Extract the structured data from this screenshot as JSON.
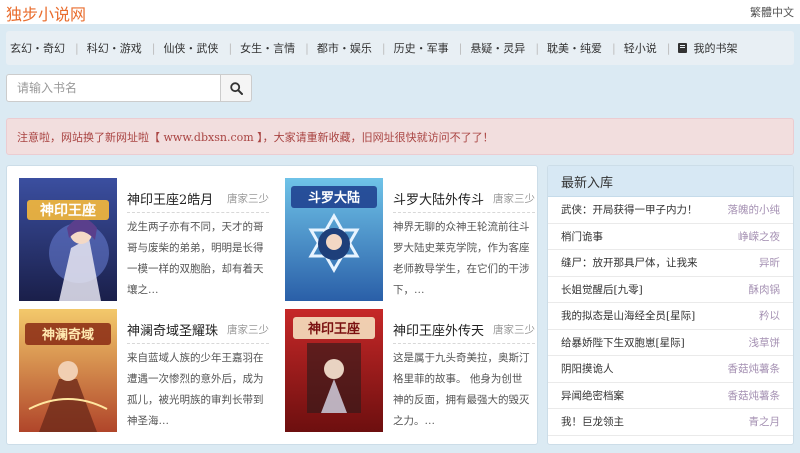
{
  "header": {
    "site_title": "独步小说网",
    "lang_toggle": "繁體中文"
  },
  "nav": {
    "items": [
      "玄幻・奇幻",
      "科幻・游戏",
      "仙侠・武侠",
      "女生・言情",
      "都市・娱乐",
      "历史・军事",
      "悬疑・灵异",
      "耽美・纯爱",
      "轻小说"
    ],
    "bookshelf": "我的书架",
    "separator": "|"
  },
  "search": {
    "placeholder": "请输入书名",
    "icon": "search-icon"
  },
  "notice": {
    "text": "注意啦，网站换了新网址啦【 www.dbxsn.com 】，大家请重新收藏，旧网址很快就访问不了了！"
  },
  "featured": [
    {
      "title": "神印王座2皓月",
      "author": "唐家三少",
      "desc": "龙生两子亦有不同，天才的哥哥与废柴的弟弟，明明是长得一模一样的双胞胎，却有着天壤之…",
      "cover_text": "神印王座"
    },
    {
      "title": "斗罗大陆外传斗",
      "author": "唐家三少",
      "desc": "神界无聊的众神王轮流前往斗罗大陆史莱克学院，作为客座老师教导学生，在它们的干涉下，…",
      "cover_text": "斗罗大陆"
    },
    {
      "title": "神澜奇域圣耀珠",
      "author": "唐家三少",
      "desc": "来自蓝域人族的少年王嘉羽在遭遇一次惨烈的意外后，成为孤儿，被光明族的审判长带到神圣海…",
      "cover_text": "神澜奇域"
    },
    {
      "title": "神印王座外传天",
      "author": "唐家三少",
      "desc": "这是属于九头奇美拉，奥斯汀格里菲的故事。 他身为创世神的反面，拥有最强大的毁灭之力。…",
      "cover_text": "神印王座"
    }
  ],
  "sidebar": {
    "heading": "最新入库",
    "items": [
      {
        "title": "武侠：开局获得一甲子内力！",
        "author": "落魄的小纯"
      },
      {
        "title": "梢门诡事",
        "author": "峥嵘之夜"
      },
      {
        "title": "缝尸：放开那具尸体，让我来",
        "author": "异昕"
      },
      {
        "title": "长姐觉醒后[九零]",
        "author": "酥肉锅"
      },
      {
        "title": "我的拟态是山海经全员[星际]",
        "author": "矜以"
      },
      {
        "title": "给暴娇陛下生双胞崽[星际]",
        "author": "浅草饼"
      },
      {
        "title": "阴阳摸诡人",
        "author": "香菇炖薯条"
      },
      {
        "title": "异闻绝密档案",
        "author": "香菇炖薯条"
      },
      {
        "title": "我！巨龙领主",
        "author": "青之月"
      }
    ]
  },
  "colors": {
    "brand": "#e96d2e",
    "background": "#dbeaf3",
    "author_purple": "#a591b3",
    "notice_text": "#a94442"
  }
}
